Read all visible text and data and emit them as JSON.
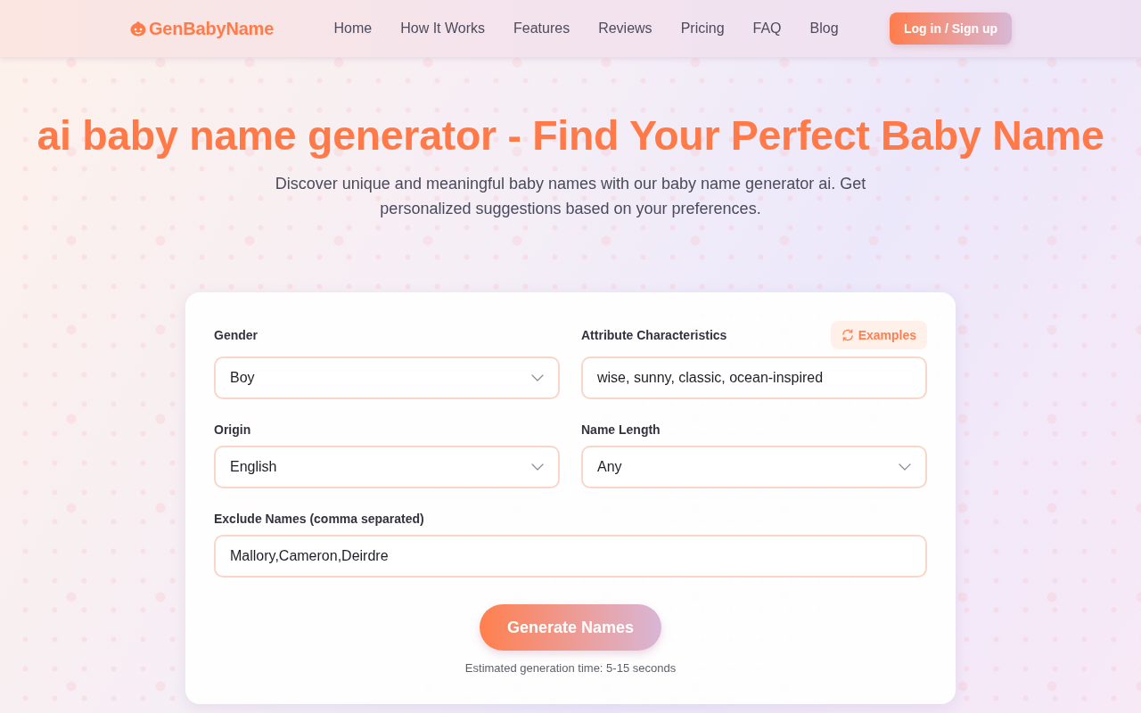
{
  "header": {
    "logo": "GenBabyName",
    "nav": [
      "Home",
      "How It Works",
      "Features",
      "Reviews",
      "Pricing",
      "FAQ",
      "Blog"
    ],
    "login_button": "Log in / Sign up"
  },
  "hero": {
    "title": "ai baby name generator - Find Your Perfect Baby Name",
    "subtitle": "Discover unique and meaningful baby names with our baby name generator ai. Get personalized suggestions based on your preferences."
  },
  "form": {
    "rows": [
      [
        {
          "kind": "select",
          "label": "Gender",
          "value": "Boy"
        },
        {
          "kind": "text",
          "label": "Attribute Characteristics",
          "value": "wise, sunny, classic, ocean-inspired",
          "action": "Examples"
        }
      ],
      [
        {
          "kind": "select",
          "label": "Origin",
          "value": "English"
        },
        {
          "kind": "select",
          "label": "Name Length",
          "value": "Any"
        }
      ],
      [
        {
          "kind": "text",
          "label": "Exclude Names (comma separated)",
          "value": "Mallory,Cameron,Deirdre"
        }
      ]
    ],
    "submit_button": "Generate Names",
    "note": "Estimated generation time: 5-15 seconds"
  }
}
